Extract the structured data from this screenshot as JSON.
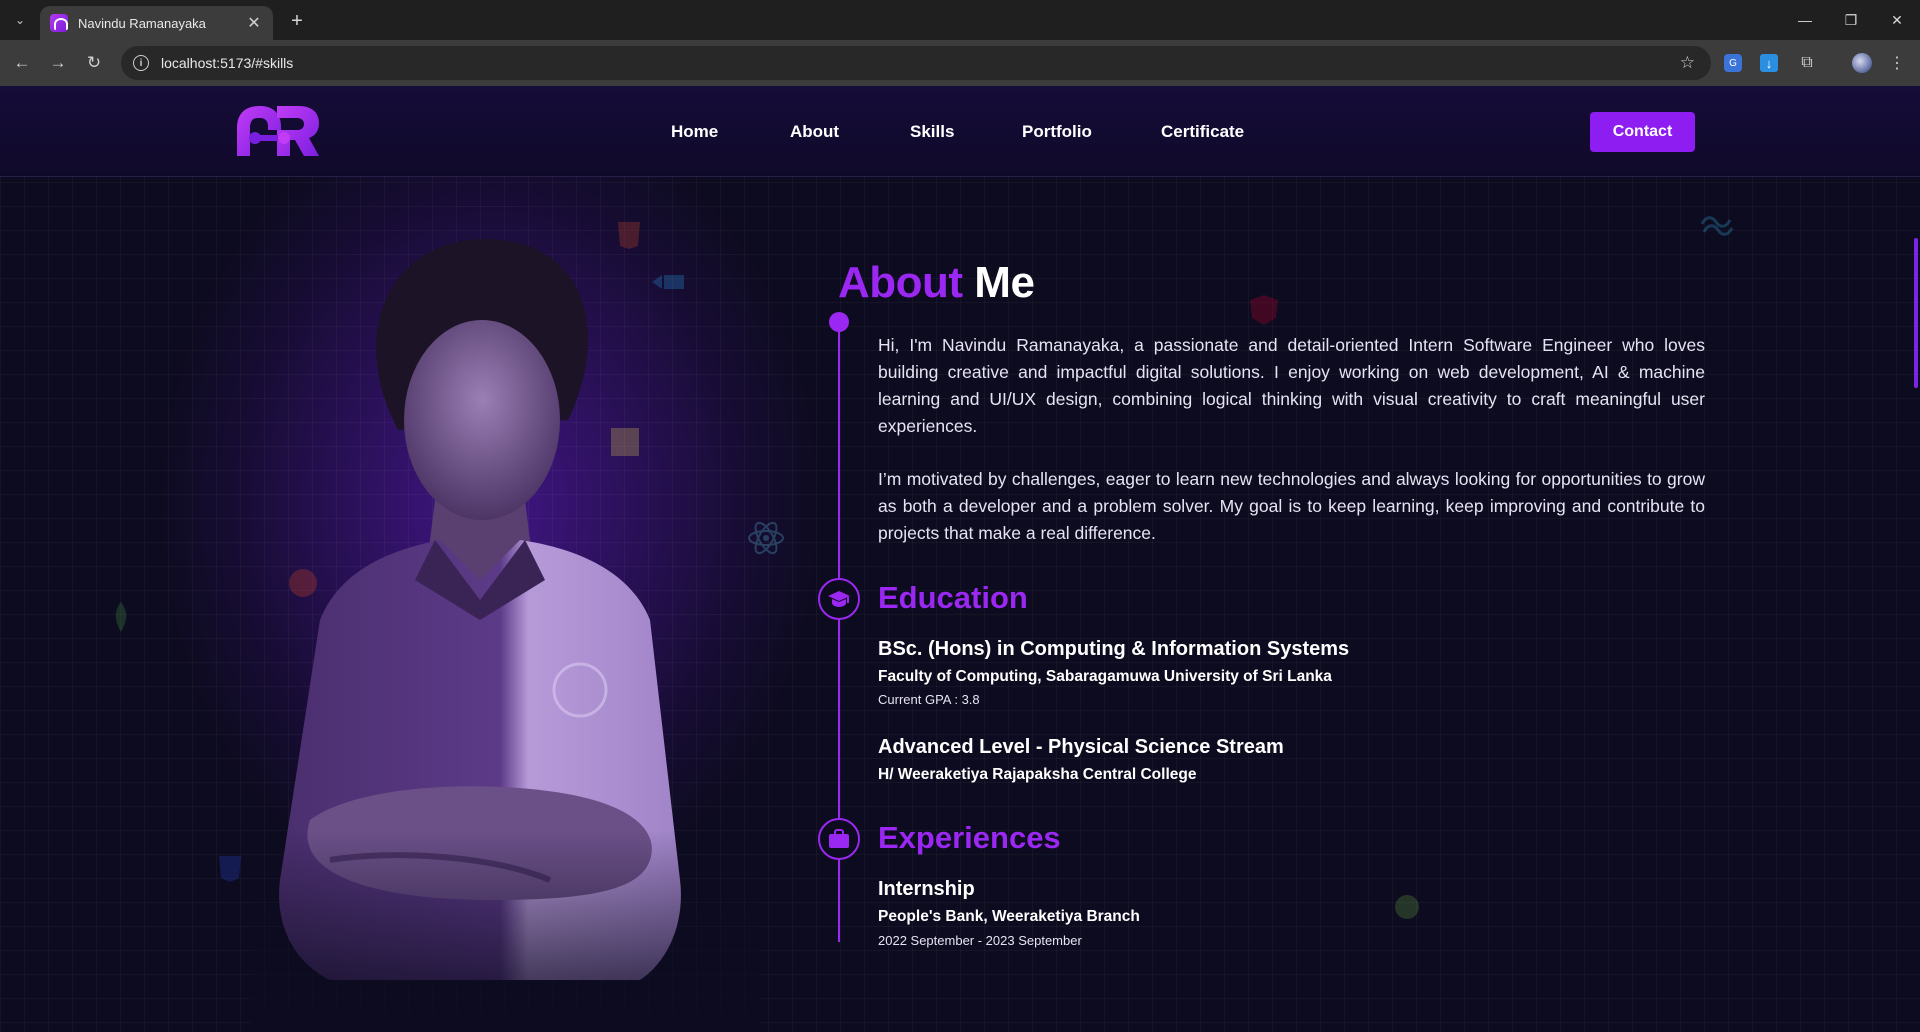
{
  "browser": {
    "tab_title": "Navindu Ramanayaka",
    "url": "localhost:5173/#skills"
  },
  "nav": {
    "items": [
      "Home",
      "About",
      "Skills",
      "Portfolio",
      "Certificate"
    ],
    "contact": "Contact"
  },
  "about": {
    "title_accent": "About",
    "title_rest": "Me",
    "paragraphs": [
      "Hi, I'm Navindu Ramanayaka, a passionate and detail-oriented Intern Software Engineer who loves building creative and impactful digital solutions. I enjoy working on web development, AI & machine learning and UI/UX design, combining logical thinking with visual creativity to craft meaningful user experiences.",
      "I’m motivated by challenges, eager to learn new technologies and always looking for opportunities to grow as both a developer and a problem solver. My goal is to keep learning, keep improving and contribute to projects that make a real difference."
    ]
  },
  "education": {
    "title": "Education",
    "items": [
      {
        "degree": "BSc. (Hons) in Computing & Information Systems",
        "institution": "Faculty of Computing, Sabaragamuwa University of Sri Lanka",
        "note": "Current GPA : 3.8"
      },
      {
        "degree": "Advanced Level - Physical Science Stream",
        "institution": "H/ Weeraketiya Rajapaksha Central College"
      }
    ]
  },
  "experiences": {
    "title": "Experiences",
    "items": [
      {
        "role": "Internship",
        "org": "People's Bank, Weeraketiya Branch",
        "period": "2022 September - 2023 September"
      }
    ]
  },
  "colors": {
    "accent": "#9b27f2",
    "contact_button": "#8d1df0",
    "background": "#0d0b1f"
  },
  "icons": [
    "graduation-cap-icon",
    "briefcase-icon"
  ]
}
